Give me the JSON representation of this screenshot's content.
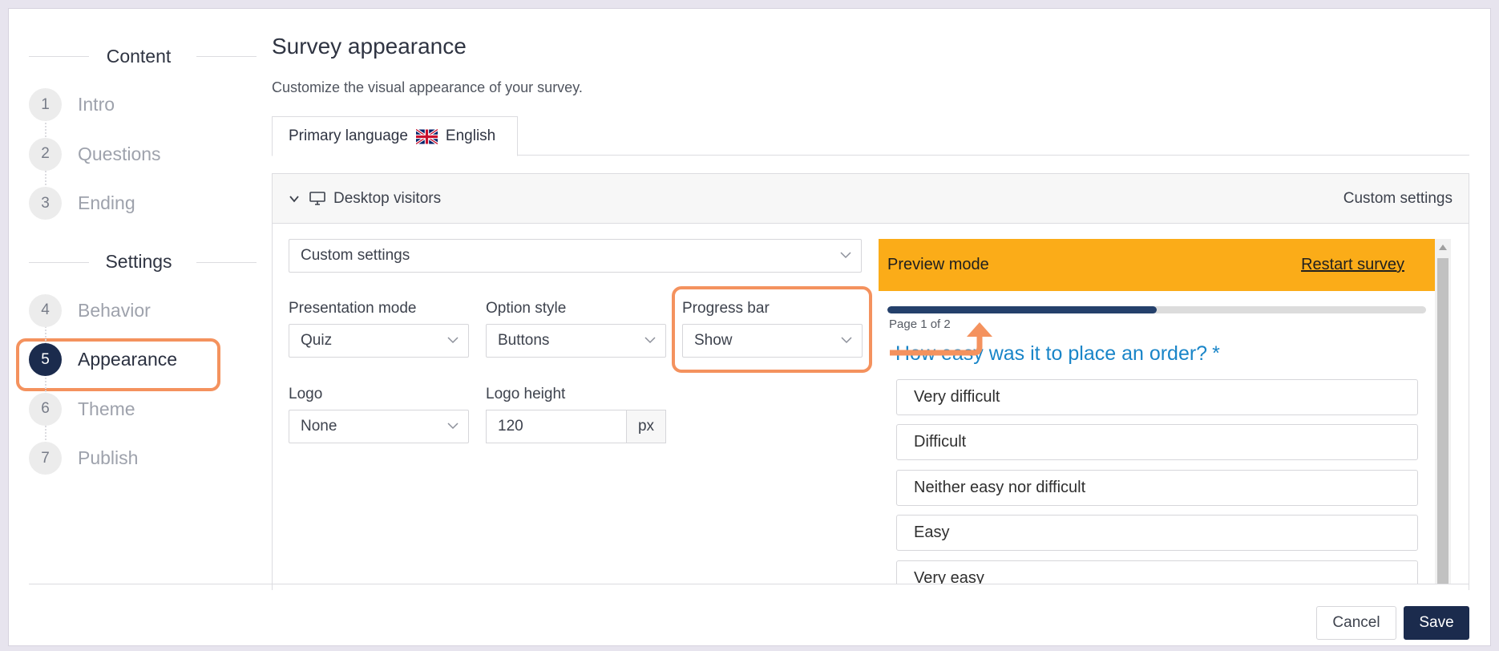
{
  "sidebar": {
    "content_heading": "Content",
    "settings_heading": "Settings",
    "content_steps": [
      {
        "num": "1",
        "label": "Intro"
      },
      {
        "num": "2",
        "label": "Questions"
      },
      {
        "num": "3",
        "label": "Ending"
      }
    ],
    "settings_steps": [
      {
        "num": "4",
        "label": "Behavior"
      },
      {
        "num": "5",
        "label": "Appearance"
      },
      {
        "num": "6",
        "label": "Theme"
      },
      {
        "num": "7",
        "label": "Publish"
      }
    ]
  },
  "main": {
    "title": "Survey appearance",
    "subtitle": "Customize the visual appearance of your survey.",
    "tab": {
      "prefix": "Primary language",
      "language": "English",
      "flag": "uk-flag-icon"
    },
    "panel": {
      "header_label": "Desktop visitors",
      "header_right": "Custom settings",
      "preset_select": "Custom settings",
      "presentation_mode": {
        "label": "Presentation mode",
        "value": "Quiz"
      },
      "option_style": {
        "label": "Option style",
        "value": "Buttons"
      },
      "progress_bar": {
        "label": "Progress bar",
        "value": "Show"
      },
      "logo": {
        "label": "Logo",
        "value": "None"
      },
      "logo_height": {
        "label": "Logo height",
        "value": "120",
        "unit": "px"
      }
    }
  },
  "preview": {
    "mode_label": "Preview mode",
    "restart_label": "Restart survey",
    "bar_color": "#fbac18",
    "progress_fraction": 0.5,
    "page_indicator": "Page 1 of 2",
    "question": "How easy was it to place an order?",
    "required_mark": "*",
    "options": [
      "Very difficult",
      "Difficult",
      "Neither easy nor difficult",
      "Easy",
      "Very easy"
    ]
  },
  "footer": {
    "cancel_label": "Cancel",
    "save_label": "Save"
  },
  "colors": {
    "accent": "#1b2b4d",
    "highlight": "#f4925e"
  }
}
